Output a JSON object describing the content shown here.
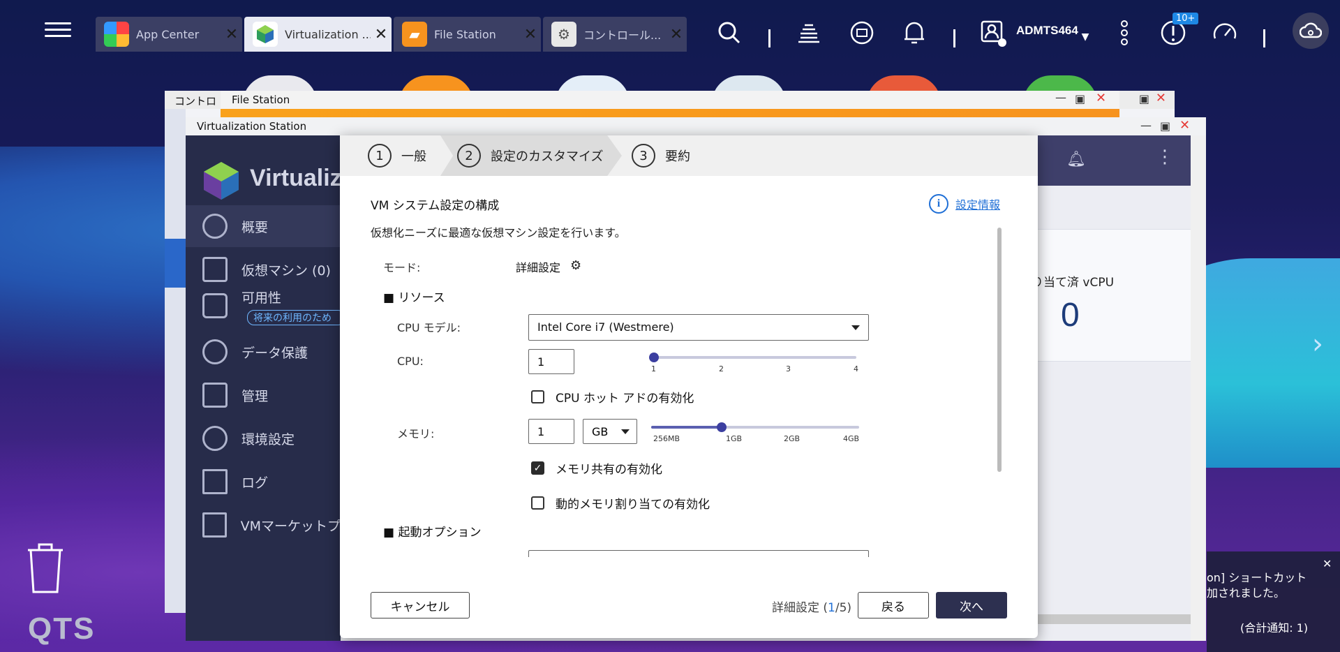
{
  "taskbar": {
    "tabs": [
      {
        "label": "App Center"
      },
      {
        "label": "Virtualization ..."
      },
      {
        "label": "File Station"
      },
      {
        "label": "コントロール..."
      }
    ],
    "user": "ADMTS464",
    "notification_badge": "10+"
  },
  "desktop": {
    "brand": "QTS"
  },
  "windows": {
    "control_title": "コントロ",
    "file_title": "File Station",
    "virt_title": "Virtualization Station"
  },
  "virt": {
    "brand": "Virtualiz",
    "nav": [
      {
        "label": "概要"
      },
      {
        "label": "仮想マシン (0)"
      },
      {
        "label": "可用性"
      },
      {
        "label": "データ保護"
      },
      {
        "label": "管理"
      },
      {
        "label": "環境設定"
      },
      {
        "label": "ログ"
      },
      {
        "label": "VMマーケットプ"
      }
    ],
    "availability_sub": "将来の利用のため",
    "vcpu_label": "り当て済 vCPU",
    "vcpu_value": "0"
  },
  "notification": {
    "line1": "on] ショートカット",
    "line2": "加されました。",
    "summary": "(合計通知: 1)"
  },
  "dialog": {
    "steps": [
      {
        "num": "1",
        "label": "一般"
      },
      {
        "num": "2",
        "label": "設定のカスタマイズ"
      },
      {
        "num": "3",
        "label": "要約"
      }
    ],
    "title": "VM システム設定の構成",
    "description": "仮想化ニーズに最適な仮想マシン設定を行います。",
    "info_link": "設定情報",
    "mode_label": "モード:",
    "mode_value": "詳細設定",
    "resources_section": "■ リソース",
    "cpu_model_label": "CPU モデル:",
    "cpu_model_value": "Intel Core i7 (Westmere)",
    "cpu_label": "CPU:",
    "cpu_value": "1",
    "cpu_slider": {
      "ticks": [
        "1",
        "2",
        "3",
        "4"
      ],
      "value": 1
    },
    "cpu_hotplug_label": "CPU ホット アドの有効化",
    "cpu_hotplug_checked": false,
    "memory_label": "メモリ:",
    "memory_value": "1",
    "memory_unit": "GB",
    "memory_slider": {
      "ticks": [
        "256MB",
        "1GB",
        "2GB",
        "4GB"
      ],
      "value": "1GB"
    },
    "memory_share_label": "メモリ共有の有効化",
    "memory_share_checked": true,
    "dynamic_memory_label": "動的メモリ割り当ての有効化",
    "dynamic_memory_checked": false,
    "boot_section": "■ 起動オプション",
    "cancel": "キャンセル",
    "pager_prefix": "詳細設定 (",
    "pager_current": "1",
    "pager_suffix": "/5)",
    "back": "戻る",
    "next": "次へ"
  }
}
